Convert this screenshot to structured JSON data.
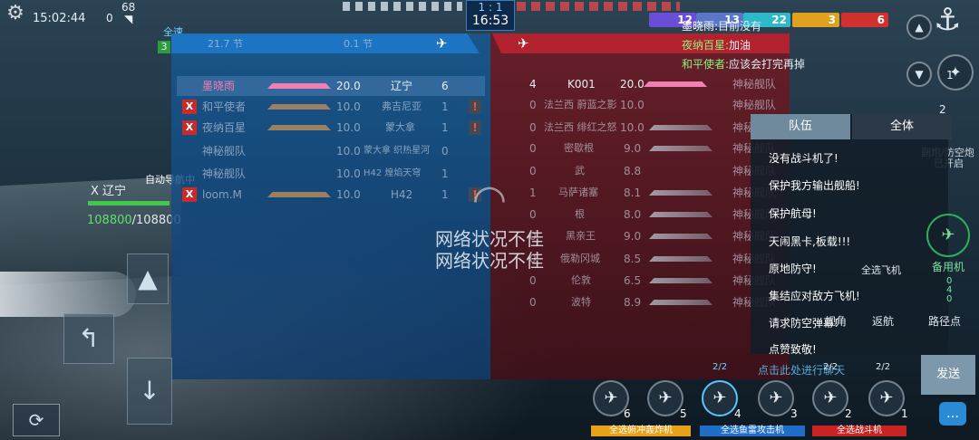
{
  "hud": {
    "time": "15:02:44",
    "left_count": "0",
    "ping": "68",
    "score": "1 : 1",
    "timer": "16:53",
    "ally_tag": "全速",
    "ally_level": "3",
    "nav_status": "自动导航中",
    "ship_name": "X 辽宁",
    "hp_current": "108800",
    "hp_total": "/108800"
  },
  "team_badges": [
    {
      "value": "12",
      "color": "#6a4fd6"
    },
    {
      "value": "13",
      "color": "#5a76c8"
    },
    {
      "value": "22",
      "color": "#2fb8c8"
    },
    {
      "value": "3",
      "color": "#e0a21e"
    },
    {
      "value": "6",
      "color": "#d33030"
    }
  ],
  "scoreboard": {
    "blue_header_row": {
      "col1": "21.7 节",
      "col2": "0.1 节"
    },
    "blue_rows": [
      {
        "player": "墨晓雨",
        "score": "20.0",
        "ship": "辽宁",
        "count": "6",
        "kicked": false,
        "warn": false,
        "highlight": true
      },
      {
        "player": "和平使者",
        "score": "10.0",
        "ship": "弗吉尼亚",
        "count": "1",
        "kicked": true,
        "warn": true,
        "highlight": false
      },
      {
        "player": "夜纳百星",
        "score": "10.0",
        "ship": "蒙大拿",
        "count": "1",
        "kicked": true,
        "warn": true,
        "highlight": false
      },
      {
        "player": "神秘舰队",
        "score": "10.0",
        "ship": "蒙大拿 织热星河",
        "count": "0",
        "kicked": false,
        "warn": false,
        "highlight": false
      },
      {
        "player": "神秘舰队",
        "score": "10.0",
        "ship": "H42 煌焰天穹",
        "count": "1",
        "kicked": false,
        "warn": false,
        "highlight": false
      },
      {
        "player": "loom.M",
        "score": "10.0",
        "ship": "H42",
        "count": "1",
        "kicked": true,
        "warn": true,
        "highlight": false
      }
    ],
    "red_rows": [
      {
        "count": "4",
        "ship": "K001",
        "score": "20.0",
        "player": "神秘舰队"
      },
      {
        "count": "0",
        "ship": "法兰西 蔚蓝之影",
        "score": "10.0",
        "player": "神秘舰队"
      },
      {
        "count": "0",
        "ship": "法兰西 绯红之怒",
        "score": "10.0",
        "player": "神秘舰队"
      },
      {
        "count": "0",
        "ship": "密歇根",
        "score": "9.0",
        "player": "神秘舰队"
      },
      {
        "count": "0",
        "ship": "武",
        "score": "8.8",
        "player": "神秘舰队"
      },
      {
        "count": "1",
        "ship": "马萨诸塞",
        "score": "8.1",
        "player": "神秘舰队"
      },
      {
        "count": "0",
        "ship": "根",
        "score": "8.0",
        "player": "神秘舰队"
      },
      {
        "count": "0",
        "ship": "黑亲王",
        "score": "9.0",
        "player": "神秘舰队"
      },
      {
        "count": "0",
        "ship": "俄勒冈城",
        "score": "8.5",
        "player": "神秘舰队"
      },
      {
        "count": "0",
        "ship": "伦敦",
        "score": "6.5",
        "player": "神秘舰队"
      },
      {
        "count": "0",
        "ship": "波特",
        "score": "8.9",
        "player": "神秘舰队"
      }
    ]
  },
  "network_warning": [
    "网络状况不佳",
    "网络状况不佳"
  ],
  "chat_log": [
    {
      "name": "墨晓雨:",
      "text": "目前没有"
    },
    {
      "name": "夜纳百星:",
      "text": "加油"
    },
    {
      "name": "和平使者:",
      "text": "应该会打完再掉"
    }
  ],
  "chat_panel": {
    "tabs": [
      "队伍",
      "全体"
    ],
    "quick_messages": [
      "没有战斗机了!",
      "保护我方输出舰船!",
      "保护航母!",
      "天闹黑卡,板载!!!",
      "原地防守!",
      "集结应对敌方飞机!",
      "请求防空弹幕!",
      "点赞致敬!"
    ],
    "input_placeholder": "点击此处进行聊天",
    "send_label": "发送"
  },
  "right_controls": {
    "view_label": "视角",
    "return_label": "返航",
    "waypoint_label": "路径点",
    "standby_label": "备用机",
    "select_all_planes": "全选飞机",
    "fire_label": "副炮/防空炮",
    "fire_status": "已开启",
    "counter_1": "1",
    "counter_2": "2",
    "side_counts": [
      "0",
      "4",
      "0"
    ]
  },
  "aircraft": {
    "groups": [
      {
        "label": "全选俯冲轰炸机",
        "color": "#e8a21a"
      },
      {
        "label": "全选鱼雷攻击机",
        "color": "#1f6ec8"
      },
      {
        "label": "全选战斗机",
        "color": "#c82424"
      }
    ],
    "slots": [
      {
        "icon": "bomber-icon",
        "count": "6"
      },
      {
        "icon": "bomber-icon",
        "count": "5"
      },
      {
        "icon": "torpedo-plane-icon",
        "count": "4"
      },
      {
        "icon": "torpedo-plane-icon",
        "count": "3"
      },
      {
        "icon": "fighter-icon",
        "count": "2"
      },
      {
        "icon": "fighter-icon",
        "count": "1"
      }
    ],
    "squad_labels": [
      "2/2",
      "2/2",
      "2/2"
    ]
  }
}
